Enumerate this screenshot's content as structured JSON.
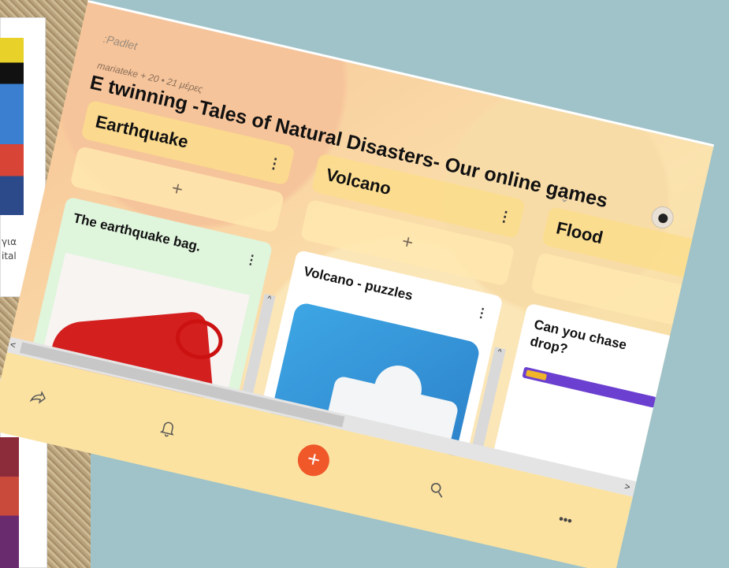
{
  "background": {
    "left_text_line1": "για",
    "left_text_line2": "ital"
  },
  "padlet": {
    "brand": ":Padlet",
    "meta": "mariateke + 20 • 21 μέρες",
    "title": "E twinning -Tales of Natural Disasters- Our online games",
    "columns": [
      {
        "title": "Earthquake",
        "card_title": "The earthquake bag."
      },
      {
        "title": "Volcano",
        "card_title": "Volcano - puzzles"
      },
      {
        "title": "Flood",
        "card_title": "Can you chase drop?"
      }
    ],
    "glyphs": {
      "menu": "⋮",
      "add": "+",
      "chevron": "⌄",
      "scroll_up": "^",
      "scroll_down": "v",
      "scroll_left": "<",
      "scroll_right": ">"
    },
    "bottom_bar": {
      "share_icon": "share-icon",
      "bell_icon": "bell-icon",
      "add_icon": "+",
      "search_icon": "search-icon",
      "more_icon": "•••"
    },
    "colors": {
      "accent": "#f0582a",
      "column_header": "#fcdd8c",
      "bottom_bar": "#fbe2a0"
    }
  }
}
